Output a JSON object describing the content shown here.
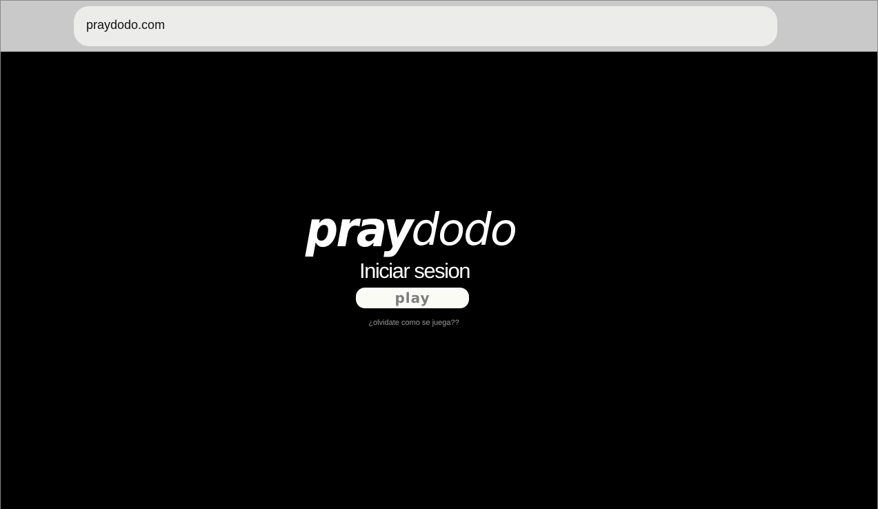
{
  "browser": {
    "address": "praydodo.com"
  },
  "logo": {
    "part1": "pray",
    "part2": "dodo"
  },
  "login": {
    "title": "Iniciar sesion",
    "play_label": "play",
    "help_link": "¿olvidate  como se juega??"
  },
  "colors": {
    "page_background": "#000000",
    "browser_bar": "#c9c9c9",
    "address_bar": "#ececea",
    "button_background": "#fbfbf6",
    "button_text": "#7d7d7d",
    "link_text": "#9a9a9a"
  }
}
